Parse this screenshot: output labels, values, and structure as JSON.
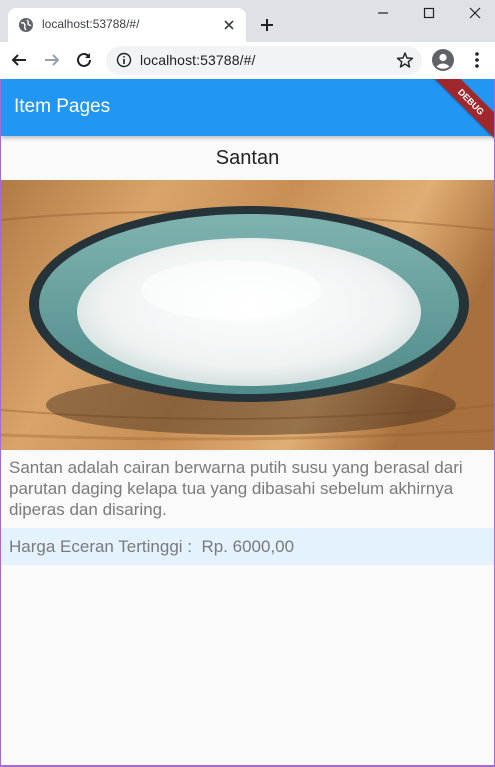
{
  "browser": {
    "tab_title": "localhost:53788/#/",
    "url": "localhost:53788/#/",
    "icons": {
      "favicon": "globe-icon",
      "tab_close": "close-icon",
      "new_tab": "plus-icon",
      "minimize": "minimize-icon",
      "maximize": "maximize-icon",
      "close": "close-icon",
      "back": "back-arrow-icon",
      "forward": "forward-arrow-icon",
      "reload": "reload-icon",
      "info": "info-icon",
      "bookmark": "star-icon",
      "profile": "profile-icon",
      "menu": "menu-dots-icon"
    }
  },
  "appbar": {
    "title": "Item Pages",
    "debug_label": "DEBUG",
    "color": "#2196f3"
  },
  "item": {
    "name": "Santan",
    "image_icon": "coconut-milk-bowl-photo",
    "description": "Santan adalah cairan berwarna putih susu yang berasal dari parutan daging kelapa tua yang dibasahi sebelum akhirnya diperas dan disaring.",
    "price_text": "Harga Eceran Tertinggi :  Rp. 6000,00",
    "price_bg": "#e3f2fd"
  }
}
